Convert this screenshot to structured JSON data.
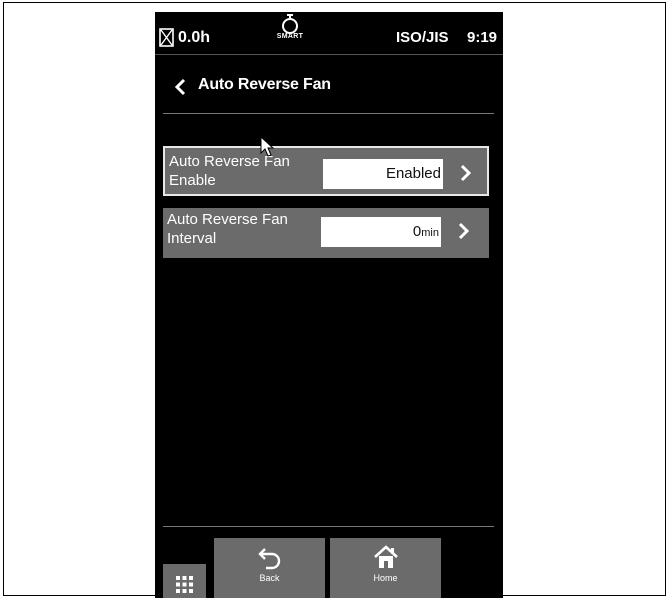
{
  "status_bar": {
    "hour_meter": "0.0h",
    "engine_mode": "SMART",
    "standard": "ISO/JIS",
    "time": "9:19"
  },
  "header": {
    "title": "Auto Reverse Fan"
  },
  "settings": [
    {
      "label_line1": "Auto Reverse Fan",
      "label_line2": "Enable",
      "value": "Enabled",
      "unit": "",
      "selected": true
    },
    {
      "label_line1": "Auto Reverse Fan",
      "label_line2": "Interval",
      "value": "0",
      "unit": "min",
      "selected": false
    }
  ],
  "nav": {
    "back_label": "Back",
    "home_label": "Home"
  },
  "colors": {
    "screen_bg": "#000000",
    "row_bg": "#6b6b6b",
    "value_bg": "#ffffff",
    "selected_border": "#e8e8e8"
  },
  "icons": [
    "hourglass-icon",
    "engine-icon",
    "back-arrow-icon",
    "chevron-right-icon",
    "grid-menu-icon",
    "undo-icon",
    "home-icon",
    "mouse-cursor-icon"
  ]
}
